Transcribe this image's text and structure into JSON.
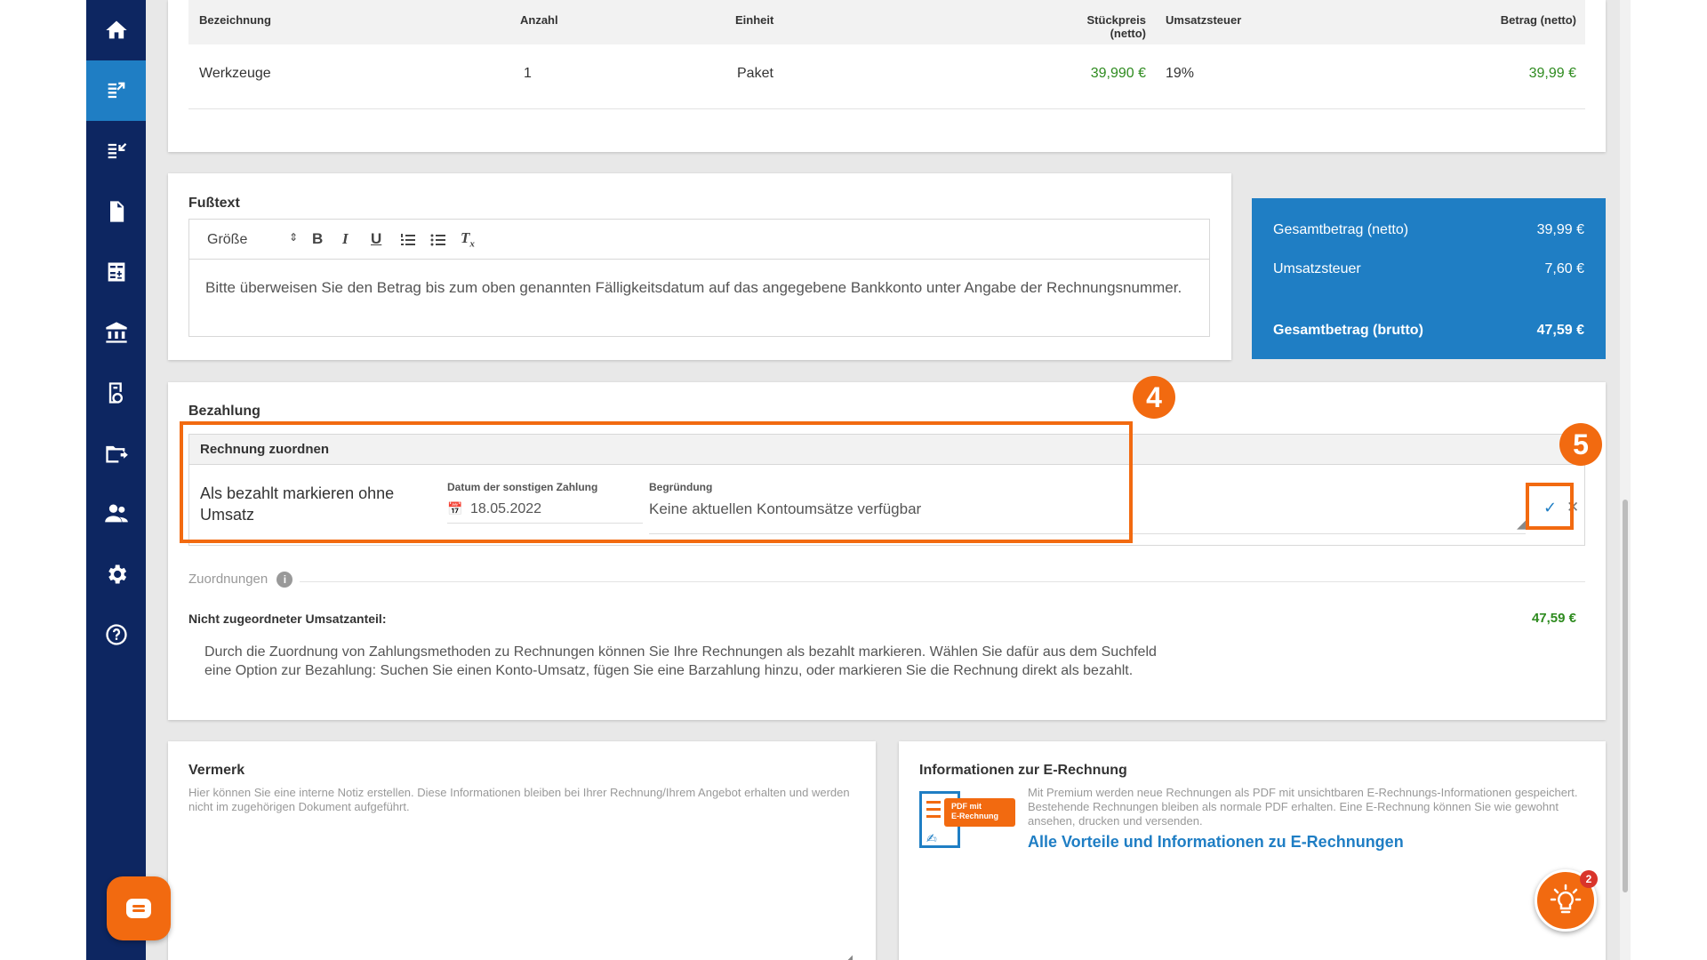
{
  "sidebar": {
    "items": [
      {
        "icon": "home-icon"
      },
      {
        "icon": "invoice-out-icon",
        "active": true
      },
      {
        "icon": "invoice-in-icon"
      },
      {
        "icon": "document-icon"
      },
      {
        "icon": "calculator-icon"
      },
      {
        "icon": "bank-icon"
      },
      {
        "icon": "receipt-icon"
      },
      {
        "icon": "folder-export-icon"
      },
      {
        "icon": "contacts-icon"
      },
      {
        "icon": "settings-icon"
      },
      {
        "icon": "help-icon"
      }
    ]
  },
  "positions": {
    "headers": {
      "name": "Bezeichnung",
      "quantity": "Anzahl",
      "unit": "Einheit",
      "unit_price": "Stückpreis (netto)",
      "vat": "Umsatzsteuer",
      "amount": "Betrag (netto)"
    },
    "rows": [
      {
        "name": "Werkzeuge",
        "quantity": "1",
        "unit": "Paket",
        "unit_price": "39,990 €",
        "vat": "19%",
        "amount": "39,99 €"
      }
    ]
  },
  "footer": {
    "title": "Fußtext",
    "size_select": "Größe",
    "text": "Bitte überweisen Sie den Betrag bis zum oben genannten Fälligkeitsdatum auf das angegebene Bankkonto unter Angabe der Rechnungsnummer."
  },
  "totals": {
    "net_label": "Gesamtbetrag (netto)",
    "net_value": "39,99 €",
    "vat_label": "Umsatzsteuer",
    "vat_value": "7,60 €",
    "gross_label": "Gesamtbetrag (brutto)",
    "gross_value": "47,59 €"
  },
  "payment": {
    "title": "Bezahlung",
    "assign_header": "Rechnung zuordnen",
    "option_label": "Als bezahlt markieren ohne Umsatz",
    "date_label": "Datum der sonstigen Zahlung",
    "date_value": "18.05.2022",
    "reason_label": "Begründung",
    "reason_value": "Keine aktuellen Kontoumsätze verfügbar",
    "marker_4": "4",
    "marker_5": "5",
    "assignments_label": "Zuordnungen",
    "unassigned_label": "Nicht zugeordneter Umsatzanteil:",
    "unassigned_value": "47,59 €",
    "help_line1": "Durch die Zuordnung von Zahlungsmethoden zu Rechnungen können Sie Ihre Rechnungen als bezahlt markieren. Wählen Sie dafür aus dem Suchfeld",
    "help_line2": "eine Option zur Bezahlung: Suchen Sie einen Konto-Umsatz, fügen Sie eine Barzahlung hinzu, oder markieren Sie die Rechnung direkt als bezahlt."
  },
  "memo": {
    "title": "Vermerk",
    "description": "Hier können Sie eine interne Notiz erstellen. Diese Informationen bleiben bei Ihrer Rechnung/Ihrem Angebot erhalten und werden nicht im zugehörigen Dokument aufgeführt."
  },
  "einvoice": {
    "title": "Informationen zur E-Rechnung",
    "description": "Mit Premium werden neue Rechnungen als PDF mit unsichtbaren E-Rechnungs-Informationen gespeichert. Bestehende Rechnungen bleiben als normale PDF erhalten. Eine E-Rechnung können Sie wie gewohnt ansehen, drucken und versenden.",
    "link": "Alle Vorteile und Informationen zu E-Rechnungen",
    "icon_tag_line1": "PDF mit",
    "icon_tag_line2": "E-Rechnung"
  },
  "notifications": {
    "count": "2"
  },
  "colors": {
    "sidebar": "#0d2661",
    "accent": "#1f7ec4",
    "highlight": "#f26a10",
    "positive": "#2e8b1f"
  }
}
